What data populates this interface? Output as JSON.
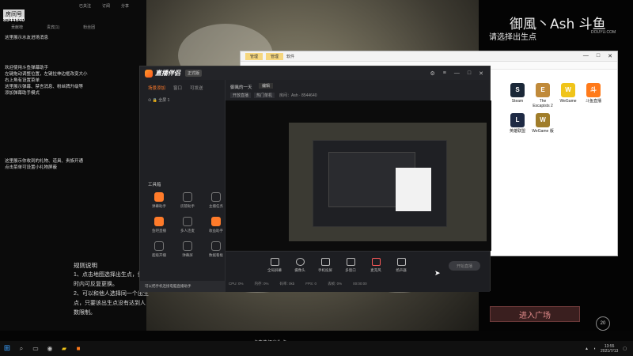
{
  "stream": {
    "left": {
      "title": "房间号",
      "uid": "8544640",
      "stats": [
        "贡献榜",
        "贵宾(1)",
        "粉丝团"
      ],
      "top_tabs": [
        "已关注",
        "订阅",
        "分享"
      ],
      "notice1": "这里展示水友进场消息",
      "notice2": "欢迎使用斗鱼弹幕助手\n左键拖动调整位置，左键拉伸边框改变大小\n右上角有设置菜单\n这里展示弹幕、禁言消息、粉丝牌升级等\n添加弹幕助手模式",
      "notice3": "这里展示你收到的礼物、道具、贵族开通\n点击菜单可设置小礼物屏蔽"
    },
    "rules": {
      "head": "规则说明",
      "line1": "1、点击地图选择出生点，倒计时内可反复更换。",
      "line2": "2、可以和他人选择同一个出生点，只要该出生点没有达到人数限制。"
    },
    "right": {
      "brand": "御風丶Ash 斗鱼",
      "brand_sub": "DOUYU.COM",
      "choose": "请选择出生点",
      "enter": "进入广场",
      "timer": "20"
    },
    "bottom": "点击选择出生点"
  },
  "explorer": {
    "tabs": [
      "管理",
      "管理",
      "软件"
    ],
    "window_buttons": [
      "—",
      "□",
      "✕"
    ],
    "apps": [
      {
        "label": "Steam",
        "color": "#1b2838",
        "icon": "steam-icon"
      },
      {
        "label": "The Escapists 2",
        "color": "#c08a3a",
        "icon": "escapists-icon"
      },
      {
        "label": "WeGame",
        "color": "#f0c419",
        "icon": "wegame-icon"
      },
      {
        "label": "斗鱼直播",
        "color": "#ff7a1a",
        "icon": "douyu-icon"
      },
      {
        "label": "英雄联盟",
        "color": "#1e2a44",
        "icon": "lol-icon"
      },
      {
        "label": "WeGame 版",
        "color": "#a07d2a",
        "icon": "wegame2-icon"
      },
      {
        "label": "",
        "color": "#ffffff",
        "icon": "blank-icon"
      },
      {
        "label": "",
        "color": "#ffffff",
        "icon": "blank-icon"
      }
    ]
  },
  "obs": {
    "app_title": "直播伴侣",
    "version_badge": "正式版",
    "sidebar_tabs": [
      "场景添加",
      "窗口",
      "可发送"
    ],
    "scene_row": "⊙ 🔒 全屏 1",
    "tool_head": "工具箱",
    "tools": [
      "弹幕助手",
      "房管助手",
      "主播任务",
      "鱼吧直播",
      "多人连麦",
      "收益助手",
      "超级开播",
      "弹幕屏",
      "数据看板"
    ],
    "stream_title": "御風的一天",
    "stream_chip": "编辑",
    "tags": [
      "开放直播",
      "热门单机"
    ],
    "room": "房间：Ash · 8544640",
    "controls": [
      "全局屏幕",
      "摄像头",
      "手机投屏",
      "多窗口",
      "麦克风",
      "扬声器"
    ],
    "golive": "开始直播",
    "status": [
      "CPU: 0%",
      "内存: 0%",
      "码率: 0kb",
      "FPS: 0",
      "丢帧: 0%",
      "00:00:00"
    ],
    "notify": "可以把手机连接电脑直播助手"
  },
  "taskbar": {
    "time": "13:55",
    "date": "2021/7/13"
  }
}
